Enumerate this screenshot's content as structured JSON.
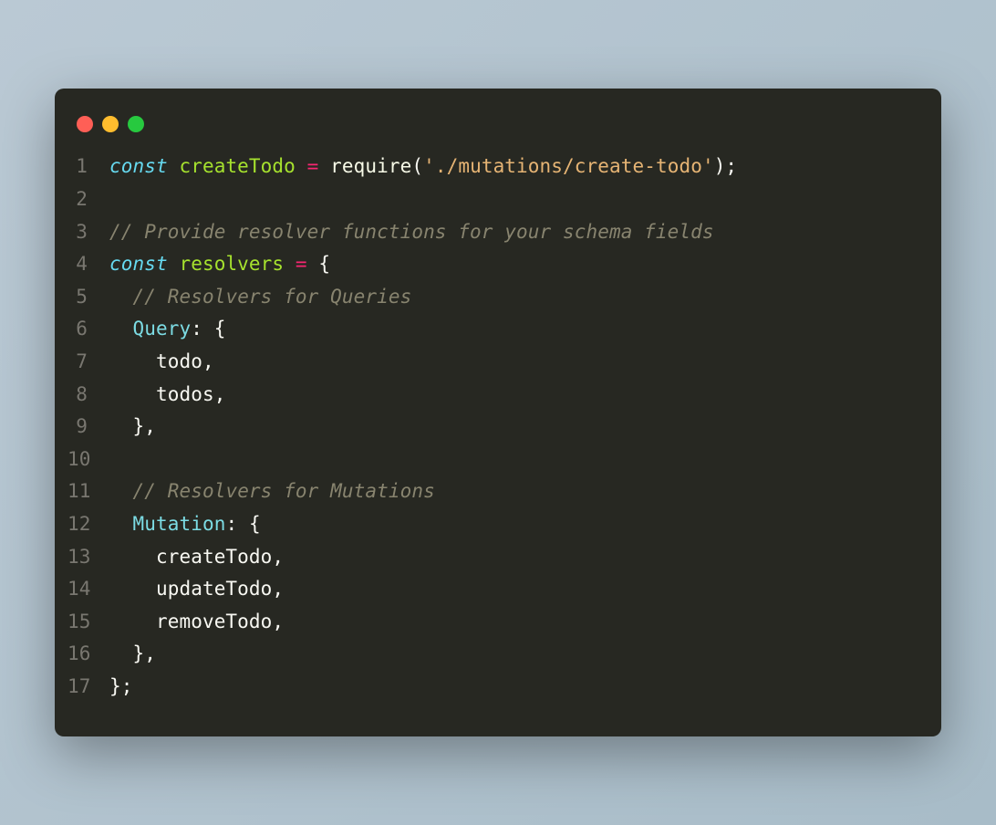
{
  "window": {
    "traffic_lights": {
      "close_color": "#ff5f56",
      "minimize_color": "#ffbd2e",
      "maximize_color": "#27c93f"
    }
  },
  "code": {
    "language": "javascript",
    "lines": [
      {
        "n": 1,
        "t": [
          {
            "c": "kw",
            "v": "const"
          },
          {
            "c": "pun",
            "v": " "
          },
          {
            "c": "name",
            "v": "createTodo"
          },
          {
            "c": "pun",
            "v": " "
          },
          {
            "c": "op",
            "v": "="
          },
          {
            "c": "pun",
            "v": " "
          },
          {
            "c": "fn",
            "v": "require"
          },
          {
            "c": "pun",
            "v": "("
          },
          {
            "c": "str",
            "v": "'./mutations/create-todo'"
          },
          {
            "c": "pun",
            "v": ");"
          }
        ]
      },
      {
        "n": 2,
        "t": []
      },
      {
        "n": 3,
        "t": [
          {
            "c": "cmt",
            "v": "// Provide resolver functions for your schema fields"
          }
        ]
      },
      {
        "n": 4,
        "t": [
          {
            "c": "kw",
            "v": "const"
          },
          {
            "c": "pun",
            "v": " "
          },
          {
            "c": "name",
            "v": "resolvers"
          },
          {
            "c": "pun",
            "v": " "
          },
          {
            "c": "op",
            "v": "="
          },
          {
            "c": "pun",
            "v": " {"
          }
        ]
      },
      {
        "n": 5,
        "t": [
          {
            "c": "pun",
            "v": "  "
          },
          {
            "c": "cmt",
            "v": "// Resolvers for Queries"
          }
        ]
      },
      {
        "n": 6,
        "t": [
          {
            "c": "pun",
            "v": "  "
          },
          {
            "c": "prop",
            "v": "Query"
          },
          {
            "c": "pun",
            "v": ": {"
          }
        ]
      },
      {
        "n": 7,
        "t": [
          {
            "c": "pun",
            "v": "    todo,"
          }
        ]
      },
      {
        "n": 8,
        "t": [
          {
            "c": "pun",
            "v": "    todos,"
          }
        ]
      },
      {
        "n": 9,
        "t": [
          {
            "c": "pun",
            "v": "  },"
          }
        ]
      },
      {
        "n": 10,
        "t": []
      },
      {
        "n": 11,
        "t": [
          {
            "c": "pun",
            "v": "  "
          },
          {
            "c": "cmt",
            "v": "// Resolvers for Mutations"
          }
        ]
      },
      {
        "n": 12,
        "t": [
          {
            "c": "pun",
            "v": "  "
          },
          {
            "c": "prop",
            "v": "Mutation"
          },
          {
            "c": "pun",
            "v": ": {"
          }
        ]
      },
      {
        "n": 13,
        "t": [
          {
            "c": "pun",
            "v": "    createTodo,"
          }
        ]
      },
      {
        "n": 14,
        "t": [
          {
            "c": "pun",
            "v": "    updateTodo,"
          }
        ]
      },
      {
        "n": 15,
        "t": [
          {
            "c": "pun",
            "v": "    removeTodo,"
          }
        ]
      },
      {
        "n": 16,
        "t": [
          {
            "c": "pun",
            "v": "  },"
          }
        ]
      },
      {
        "n": 17,
        "t": [
          {
            "c": "pun",
            "v": "};"
          }
        ]
      }
    ]
  }
}
